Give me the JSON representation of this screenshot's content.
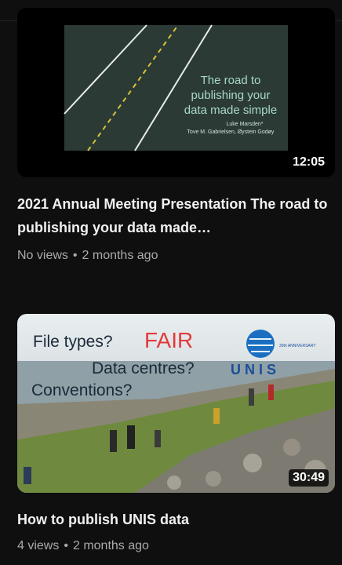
{
  "videos": [
    {
      "duration": "12:05",
      "title": "2021 Annual Meeting Presentation The road to publishing your data made…",
      "views": "No views",
      "age": "2 months ago",
      "slide": {
        "line1": "The road to",
        "line2": "publishing your",
        "line3": "data made simple",
        "author1": "Luke Marsden*",
        "author2": "Tove M. Gabrielsen, Øystein Godøy"
      }
    },
    {
      "duration": "30:49",
      "title": "How to publish UNIS data",
      "views": "4 views",
      "age": "2 months ago",
      "thumb": {
        "q1": "File types?",
        "fair": "FAIR",
        "q2": "Data centres?",
        "unis": "U N I S",
        "q3": "Conventions?",
        "anniv": "30th ANNIVERSARY"
      }
    }
  ],
  "colors": {
    "fair": "#e33a3a",
    "unis": "#1a4e9a"
  }
}
